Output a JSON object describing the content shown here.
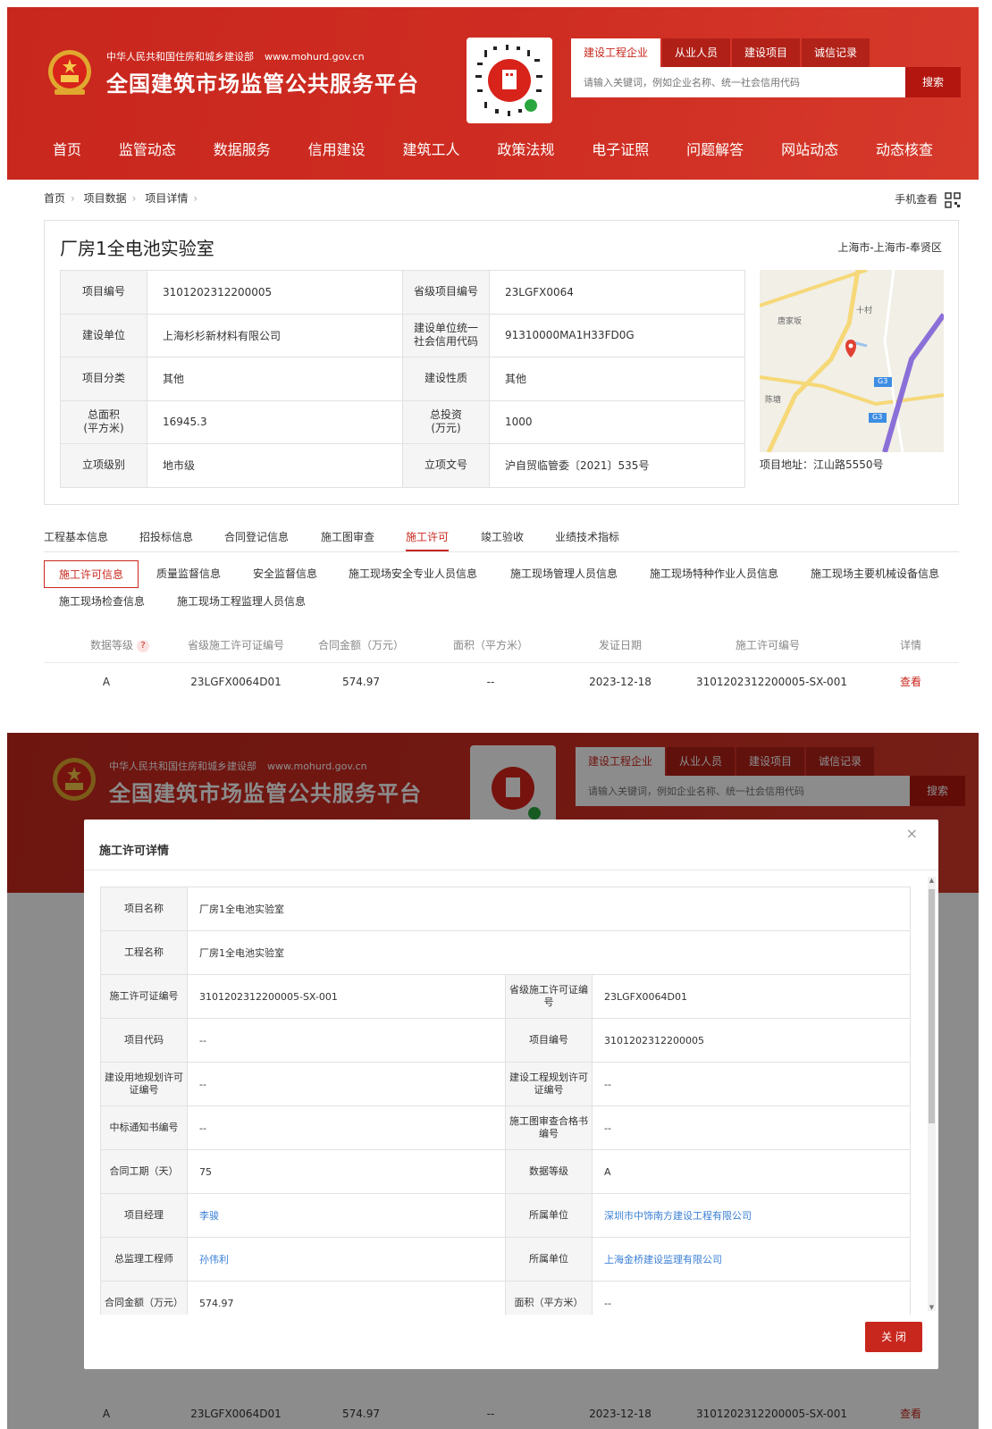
{
  "colors": {
    "brand_red": "#c8271e",
    "link_blue": "#3a7fd5"
  },
  "header": {
    "subtitle": "中华人民共和国住房和城乡建设部",
    "url": "www.mohurd.gov.cn",
    "title": "全国建筑市场监管公共服务平台",
    "search_tabs": [
      "建设工程企业",
      "从业人员",
      "建设项目",
      "诚信记录"
    ],
    "search_placeholder": "请输入关键词，例如企业名称、统一社会信用代码",
    "search_button": "搜索",
    "nav": [
      "首页",
      "监管动态",
      "数据服务",
      "信用建设",
      "建筑工人",
      "政策法规",
      "电子证照",
      "问题解答",
      "网站动态",
      "动态核查"
    ]
  },
  "breadcrumb": [
    "首页",
    "项目数据",
    "项目详情"
  ],
  "phone_view": "手机查看",
  "project": {
    "title": "厂房1全电池实验室",
    "location": "上海市-上海市-奉贤区",
    "fields": [
      [
        "项目编号",
        "3101202312200005",
        "省级项目编号",
        "23LGFX0064"
      ],
      [
        "建设单位",
        "上海杉杉新材料有限公司",
        "建设单位统一社会信用代码",
        "91310000MA1H33FD0G"
      ],
      [
        "项目分类",
        "其他",
        "建设性质",
        "其他"
      ],
      [
        "总面积(平方米)",
        "16945.3",
        "总投资(万元)",
        "1000"
      ],
      [
        "立项级别",
        "地市级",
        "立项文号",
        "沪自贸临管委〔2021〕535号"
      ]
    ],
    "map_labels": [
      "唐家坂",
      "十村",
      "陈塘",
      "G3",
      "G3"
    ],
    "address": "项目地址：江山路5550号"
  },
  "main_tabs": [
    "工程基本信息",
    "招投标信息",
    "合同登记信息",
    "施工图审查",
    "施工许可",
    "竣工验收",
    "业绩技术指标"
  ],
  "sub_tabs": [
    "施工许可信息",
    "质量监督信息",
    "安全监督信息",
    "施工现场安全专业人员信息",
    "施工现场管理人员信息",
    "施工现场特种作业人员信息",
    "施工现场主要机械设备信息",
    "施工现场检查信息",
    "施工现场工程监理人员信息"
  ],
  "permit_table": {
    "headers": [
      "数据等级",
      "省级施工许可证编号",
      "合同金额（万元）",
      "面积（平方米）",
      "发证日期",
      "施工许可编号",
      "详情"
    ],
    "help_icon": "?",
    "row": [
      "A",
      "23LGFX0064D01",
      "574.97",
      "--",
      "2023-12-18",
      "3101202312200005-SX-001",
      "查看"
    ]
  },
  "modal": {
    "title": "施工许可详情",
    "close_icon": "×",
    "close_button": "关 闭",
    "rows": [
      [
        "项目名称",
        "厂房1全电池实验室"
      ],
      [
        "工程名称",
        "厂房1全电池实验室"
      ],
      [
        "施工许可证编号",
        "3101202312200005-SX-001",
        "省级施工许可证编号",
        "23LGFX0064D01"
      ],
      [
        "项目代码",
        "--",
        "项目编号",
        "3101202312200005"
      ],
      [
        "建设用地规划许可证编号",
        "--",
        "建设工程规划许可证编号",
        "--"
      ],
      [
        "中标通知书编号",
        "--",
        "施工图审查合格书编号",
        "--"
      ],
      [
        "合同工期（天）",
        "75",
        "数据等级",
        "A"
      ],
      [
        "项目经理",
        "李骏",
        "所属单位",
        "深圳市中饰南方建设工程有限公司"
      ],
      [
        "总监理工程师",
        "孙伟利",
        "所属单位",
        "上海金桥建设监理有限公司"
      ],
      [
        "合同金额（万元）",
        "574.97",
        "面积（平方米）",
        "--"
      ]
    ]
  }
}
